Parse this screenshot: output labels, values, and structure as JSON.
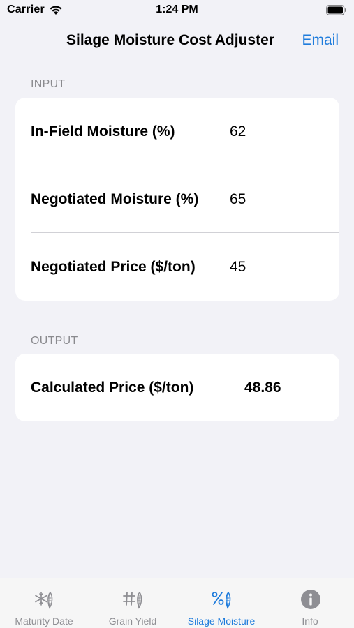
{
  "status_bar": {
    "carrier": "Carrier",
    "time": "1:24 PM"
  },
  "nav": {
    "title": "Silage Moisture Cost Adjuster",
    "email_label": "Email"
  },
  "input_section": {
    "header": "INPUT",
    "rows": [
      {
        "label": "In-Field Moisture (%)",
        "value": "62"
      },
      {
        "label": "Negotiated Moisture (%)",
        "value": "65"
      },
      {
        "label": "Negotiated Price ($/ton)",
        "value": "45"
      }
    ]
  },
  "output_section": {
    "header": "OUTPUT",
    "rows": [
      {
        "label": "Calculated Price ($/ton)",
        "value": "48.86"
      }
    ]
  },
  "tabs": [
    {
      "label": "Maturity Date",
      "icon": "snowflake-corn-icon",
      "active": false
    },
    {
      "label": "Grain Yield",
      "icon": "hash-corn-icon",
      "active": false
    },
    {
      "label": "Silage Moisture",
      "icon": "percent-corn-icon",
      "active": true
    },
    {
      "label": "Info",
      "icon": "info-icon",
      "active": false
    }
  ],
  "colors": {
    "accent": "#1f7cdc",
    "background": "#f2f2f7",
    "inactive_tab": "#8e8e93"
  }
}
